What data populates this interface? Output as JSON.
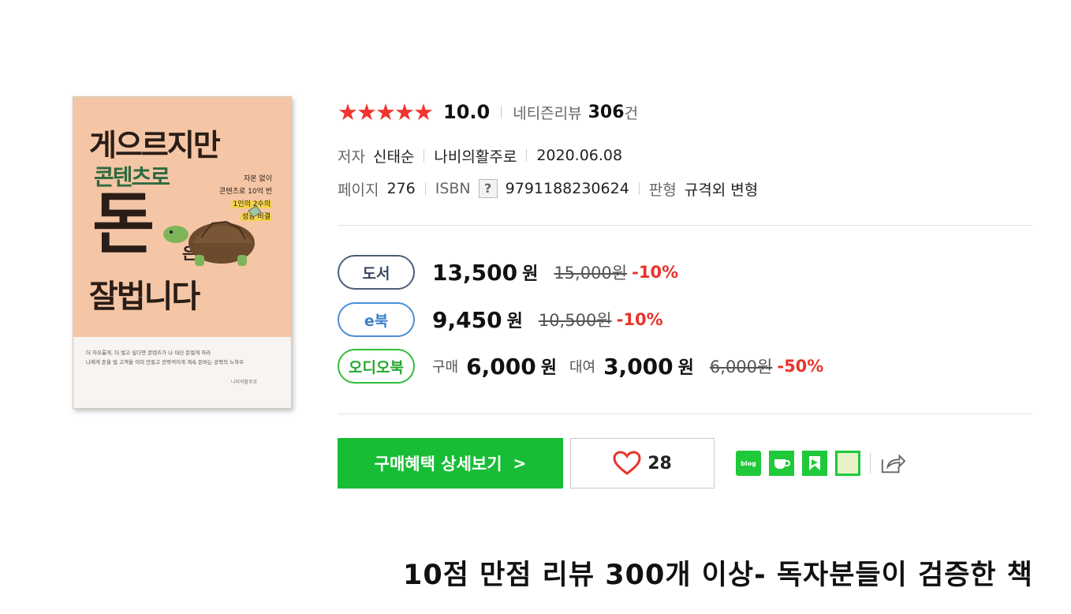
{
  "cover": {
    "title_line1": "게으르지만",
    "title_line2": "콘텐츠로",
    "title_big": "돈",
    "title_eun": "은",
    "title_line3": "잘법니다",
    "side_line1": "자본 없이",
    "side_line2": "콘텐츠로 10억 번",
    "side_line3": "1인의 2수의",
    "side_line4": "성공 비결",
    "caption_line1": "더 자유롭게, 더 벌고 싶다면 콘텐츠가 나 대신 돈벌게 하라",
    "caption_line2": "나에게 돈을 벌 고객을 이미 만들고 전략적이게 계속 돈버는 공략의 노하우",
    "publisher": "나비의활주로"
  },
  "rating": {
    "stars": "★★★★★",
    "score": "10.0",
    "reviews_label": "네티즌리뷰",
    "reviews_count": "306",
    "reviews_unit": "건"
  },
  "details": {
    "author_label": "저자",
    "author": "신태순",
    "publisher": "나비의활주로",
    "date": "2020.06.08",
    "pages_label": "페이지",
    "pages": "276",
    "isbn_label": "ISBN",
    "isbn_help": "?",
    "isbn": "9791188230624",
    "format_label": "판형",
    "format": "규격외 변형"
  },
  "prices": {
    "book": {
      "badge": "도서",
      "price": "13,500",
      "unit": "원",
      "original": "15,000원",
      "discount": "-10%"
    },
    "ebook": {
      "badge": "e북",
      "price": "9,450",
      "unit": "원",
      "original": "10,500원",
      "discount": "-10%"
    },
    "audio": {
      "badge": "오디오북",
      "buy_label": "구매",
      "buy_price": "6,000",
      "buy_unit": "원",
      "rent_label": "대여",
      "rent_price": "3,000",
      "rent_unit": "원",
      "original": "6,000원",
      "discount": "-50%"
    }
  },
  "actions": {
    "buy_benefit": "구매혜택 상세보기",
    "buy_chevron": ">",
    "like_count": "28",
    "blog_icon_text": "blog"
  },
  "headline": "10점 만점 리뷰 300개 이상- 독자분들이 검증한 책",
  "colors": {
    "star": "#f0342f",
    "discount": "#e8342b",
    "primary_green": "#18bd36",
    "book_badge": "#4d5d7a",
    "ebook_badge": "#4a8ed6",
    "audio_badge": "#2fbd3c"
  }
}
